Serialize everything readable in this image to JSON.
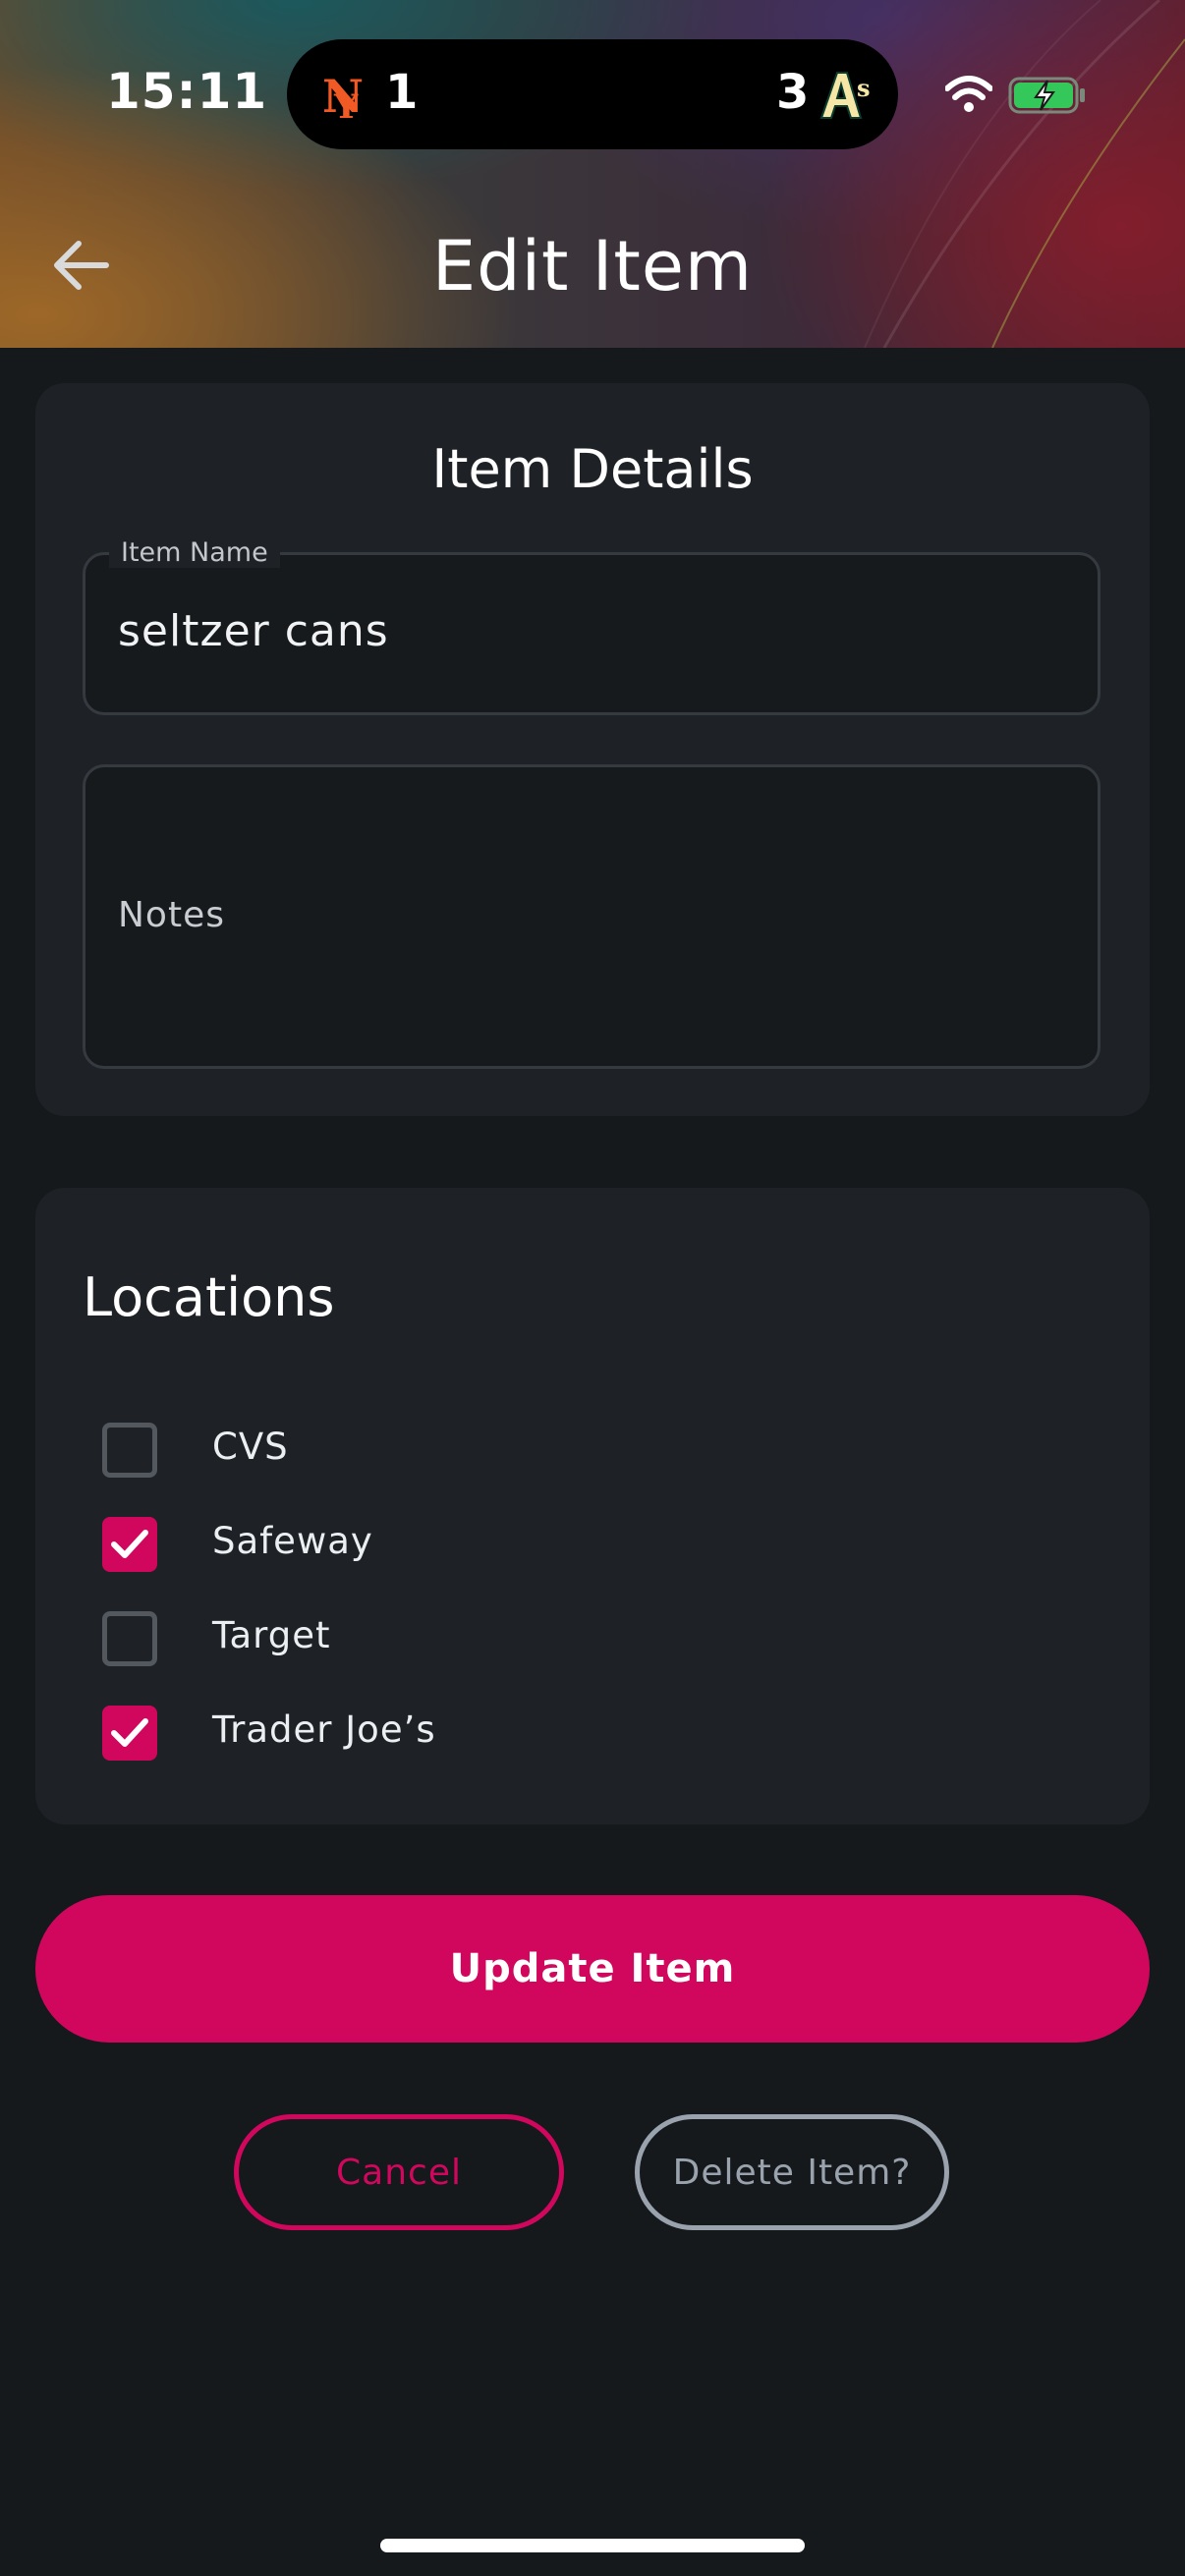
{
  "status_bar": {
    "time": "15:11",
    "live_activity": {
      "home_team_icon": "mets-logo-icon",
      "home_score": "1",
      "away_score": "3",
      "away_team_icon": "athletics-logo-icon"
    },
    "icons": [
      "wifi-icon",
      "battery-charging-icon"
    ]
  },
  "header": {
    "title": "Edit Item",
    "back_icon": "arrow-left-icon"
  },
  "item_details": {
    "title": "Item Details",
    "name_field": {
      "label": "Item Name",
      "value": "seltzer cans"
    },
    "notes_field": {
      "placeholder": "Notes",
      "value": ""
    }
  },
  "locations": {
    "title": "Locations",
    "items": [
      {
        "label": "CVS",
        "checked": false
      },
      {
        "label": "Safeway",
        "checked": true
      },
      {
        "label": "Target",
        "checked": false
      },
      {
        "label": "Trader Joe’s",
        "checked": true
      }
    ]
  },
  "actions": {
    "update_label": "Update Item",
    "cancel_label": "Cancel",
    "delete_label": "Delete Item?"
  },
  "colors": {
    "accent": "#d1075e",
    "background": "#15191c",
    "card": "#1e2226",
    "muted_outline": "#9aa3ad"
  }
}
